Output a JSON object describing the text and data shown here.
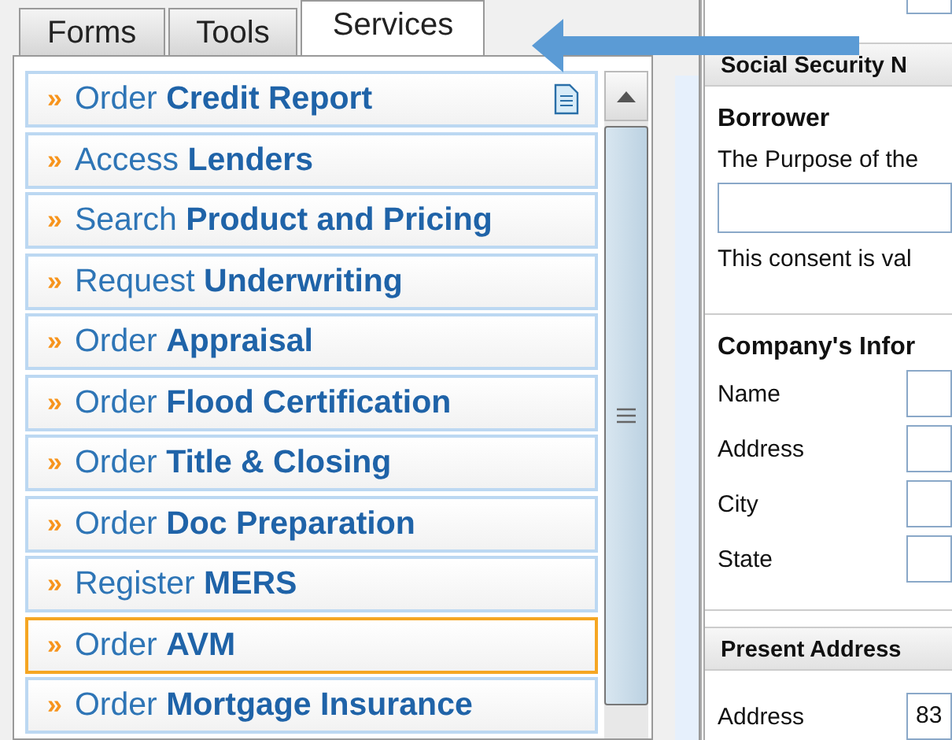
{
  "tabs": [
    {
      "label": "Forms",
      "selected": false
    },
    {
      "label": "Tools",
      "selected": false
    },
    {
      "label": "Services",
      "selected": true
    }
  ],
  "services": [
    {
      "text": "Order **Credit Report**",
      "kind": "document",
      "selected": false
    },
    {
      "text": "Access **Lenders**",
      "kind": "plain",
      "selected": false
    },
    {
      "text": "Search **Product and Pricing**",
      "kind": "plain",
      "selected": false
    },
    {
      "text": "Request **Underwriting**",
      "kind": "plain",
      "selected": false
    },
    {
      "text": "Order **Appraisal**",
      "kind": "plain",
      "selected": false
    },
    {
      "text": "Order **Flood Certification**",
      "kind": "plain",
      "selected": false
    },
    {
      "text": "Order **Title & Closing**",
      "kind": "plain",
      "selected": false
    },
    {
      "text": "Order **Doc Preparation**",
      "kind": "plain",
      "selected": false
    },
    {
      "text": "Register **MERS**",
      "kind": "plain",
      "selected": false
    },
    {
      "text": "Order **AVM**",
      "kind": "plain",
      "selected": true
    },
    {
      "text": "Order **Mortgage Insurance**",
      "kind": "plain",
      "selected": false
    }
  ],
  "bullet": "»",
  "form": {
    "ssn_header": "Social Security N",
    "borrower": {
      "title": "Borrower",
      "purpose_label": "The Purpose of the",
      "consent_text": "This consent is val"
    },
    "company": {
      "title": "Company's Infor",
      "fields": [
        {
          "label": "Name"
        },
        {
          "label": "Address"
        },
        {
          "label": "City"
        },
        {
          "label": "State"
        }
      ]
    },
    "present_address": {
      "header": "Present Address",
      "fields": [
        {
          "label": "Address",
          "value": "83"
        }
      ]
    }
  }
}
